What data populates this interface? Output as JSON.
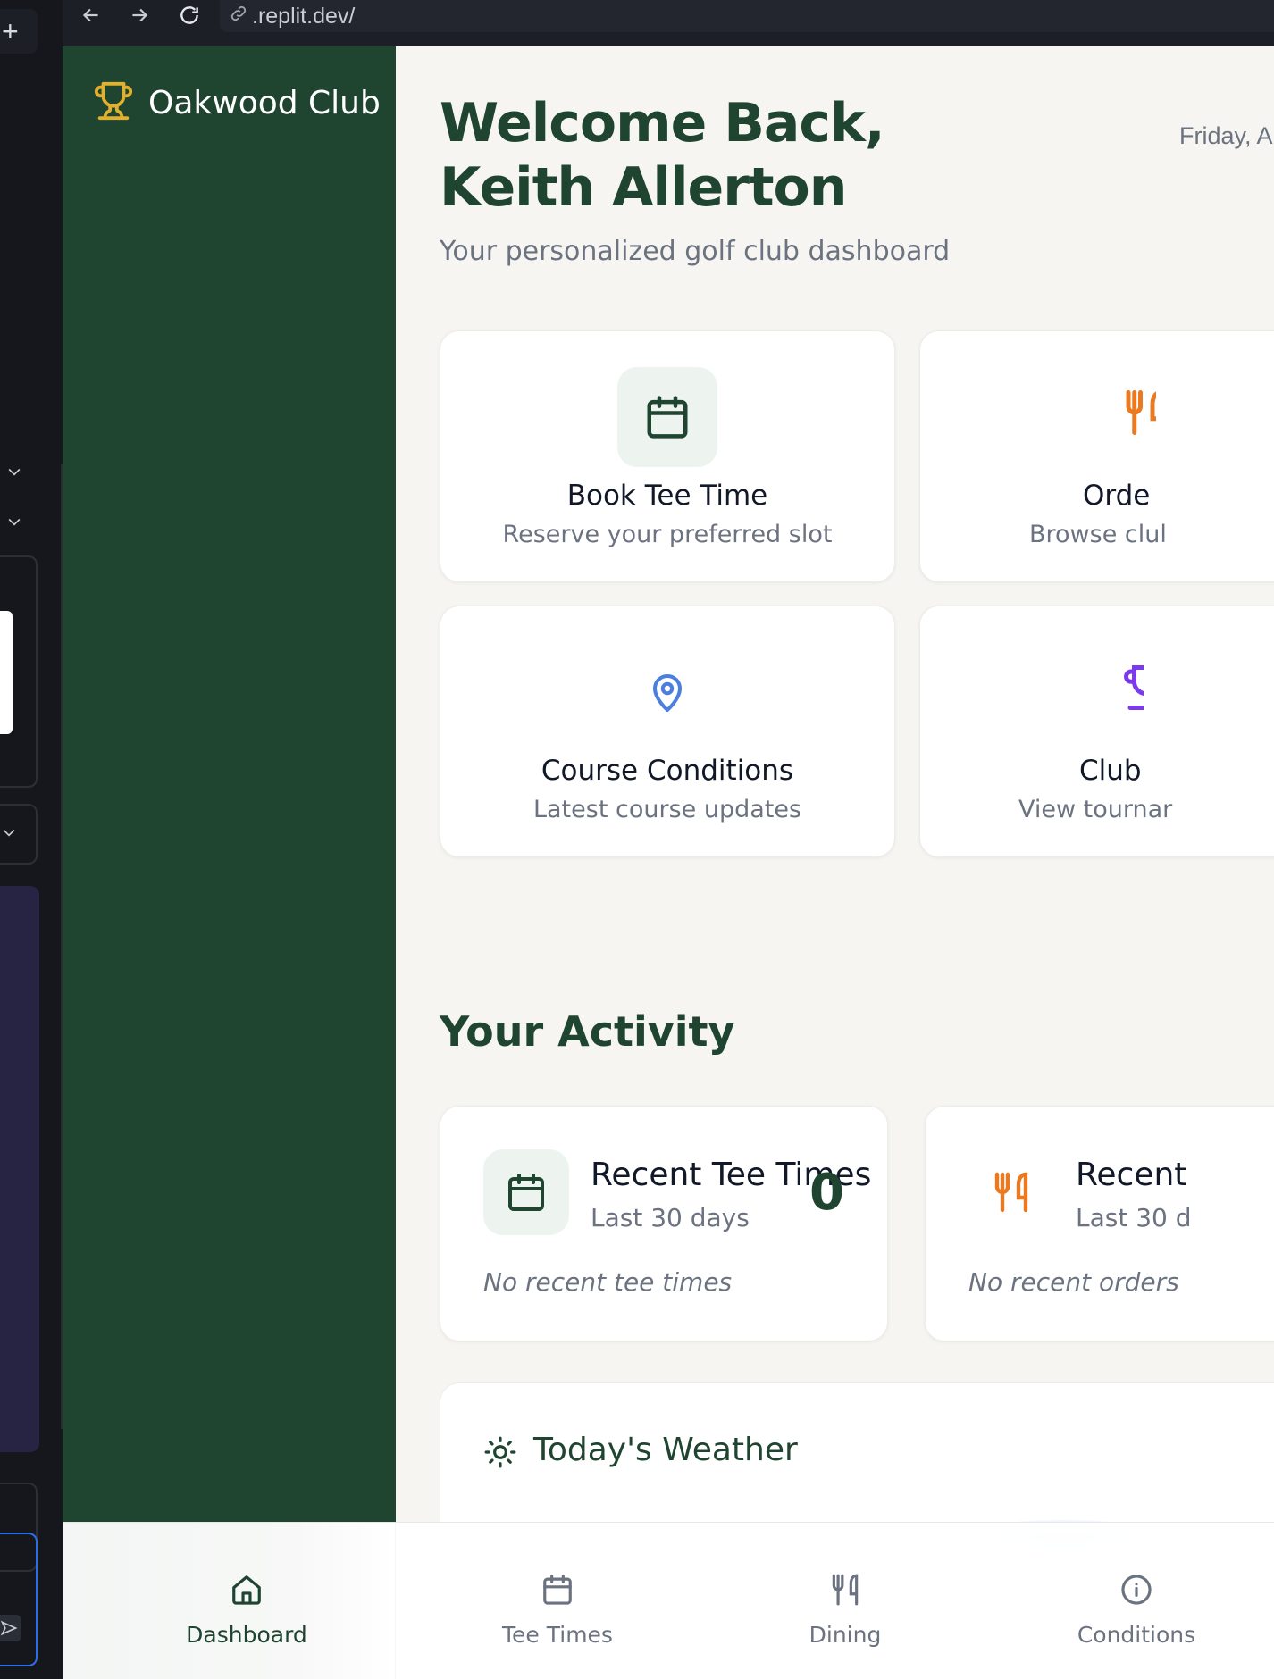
{
  "browser": {
    "url": ".replit.dev/"
  },
  "sidebar": {
    "brand": "Oakwood Club"
  },
  "header": {
    "welcome": "Welcome Back, Keith Allerton",
    "subtitle": "Your personalized golf club dashboard",
    "datetime": "Friday, A PM"
  },
  "quick_actions": [
    {
      "title": "Book Tee Time",
      "desc": "Reserve your preferred slot",
      "icon": "calendar-icon",
      "color": "#1f4430"
    },
    {
      "title": "Orde",
      "desc": "Browse clul",
      "icon": "utensils-icon",
      "color": "#ea7a22"
    },
    {
      "title": "Course Conditions",
      "desc": "Latest course updates",
      "icon": "map-pin-icon",
      "color": "#4a7fe0"
    },
    {
      "title": "Club",
      "desc": "View tournar",
      "icon": "trophy-icon",
      "color": "#7c3aed"
    }
  ],
  "activity": {
    "title": "Your Activity",
    "cards": [
      {
        "title": "Recent Tee Times",
        "sub": "Last 30 days",
        "count": "0",
        "empty": "No recent tee times",
        "icon": "calendar-icon"
      },
      {
        "title": "Recent",
        "sub": "Last 30 d",
        "empty": "No recent orders",
        "icon": "utensils-icon"
      }
    ]
  },
  "weather": {
    "title": "Today's Weather"
  },
  "bottom_nav": [
    {
      "label": "Dashboard",
      "icon": "home-icon"
    },
    {
      "label": "Tee Times",
      "icon": "calendar-icon"
    },
    {
      "label": "Dining",
      "icon": "utensils-icon"
    },
    {
      "label": "Conditions",
      "icon": "info-icon"
    }
  ],
  "colors": {
    "sidebar_green": "#1f4430",
    "accent_gold": "#e0b030",
    "page_bg": "#f6f5f1"
  }
}
